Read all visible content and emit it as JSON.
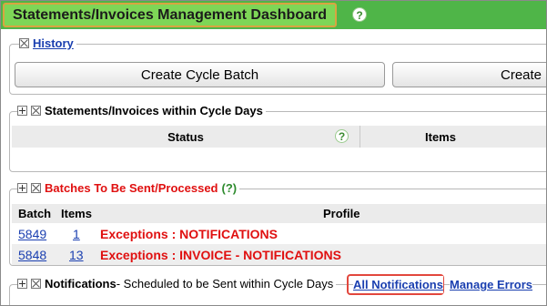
{
  "header": {
    "title": "Statements/Invoices Management Dashboard",
    "help_symbol": "?"
  },
  "history": {
    "legend": "History",
    "buttons": [
      "Create Cycle Batch",
      "Create C"
    ]
  },
  "cycle_days": {
    "legend": "Statements/Invoices within Cycle Days",
    "columns": {
      "status": "Status",
      "help_symbol": "?",
      "items": "Items"
    }
  },
  "batches": {
    "legend": "Batches To Be Sent/Processed",
    "legend_help": "(?)",
    "columns": {
      "batch": "Batch",
      "items": "Items",
      "profile": "Profile"
    },
    "rows": [
      {
        "batch": "5849",
        "items": "1",
        "profile": "Exceptions : NOTIFICATIONS"
      },
      {
        "batch": "5848",
        "items": "13",
        "profile": "Exceptions : INVOICE - NOTIFICATIONS"
      }
    ]
  },
  "notifications": {
    "legend_bold": "Notifications",
    "legend_rest": " - Scheduled to be Sent within Cycle Days",
    "all_link": "All Notifications",
    "errors_link": "Manage Errors"
  },
  "colors": {
    "header_green": "#4fb548",
    "highlight_red": "#e2473d",
    "link_blue": "#1a3fb0",
    "alert_red": "#e01010"
  }
}
